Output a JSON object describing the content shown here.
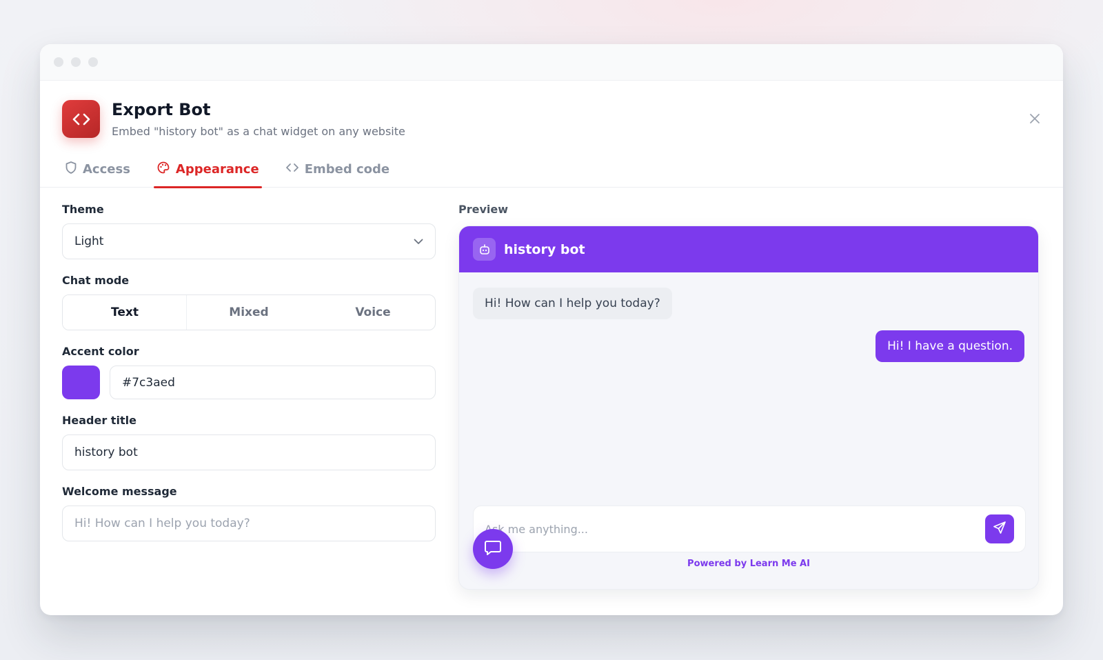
{
  "colors": {
    "accent": "#7c3aed",
    "brand_red": "#dc2626"
  },
  "dialog": {
    "icon": "code-icon",
    "title": "Export Bot",
    "subtitle": "Embed \"history bot\" as a chat widget on any website"
  },
  "tabs": [
    {
      "label": "Access",
      "icon": "shield-icon",
      "active": false
    },
    {
      "label": "Appearance",
      "icon": "palette-icon",
      "active": true
    },
    {
      "label": "Embed code",
      "icon": "code-icon",
      "active": false
    }
  ],
  "form": {
    "theme": {
      "label": "Theme",
      "value": "Light"
    },
    "chat_mode": {
      "label": "Chat mode",
      "options": [
        "Text",
        "Mixed",
        "Voice"
      ],
      "selected": "Text"
    },
    "accent_color": {
      "label": "Accent color",
      "value": "#7c3aed"
    },
    "header_title": {
      "label": "Header title",
      "value": "history bot"
    },
    "welcome_message": {
      "label": "Welcome message",
      "placeholder": "Hi! How can I help you today?"
    }
  },
  "preview": {
    "label": "Preview",
    "header_title": "history bot",
    "bot_message": "Hi! How can I help you today?",
    "user_message": "Hi! I have a question.",
    "input_placeholder": "Ask me anything...",
    "powered_by": "Powered by Learn Me AI"
  }
}
